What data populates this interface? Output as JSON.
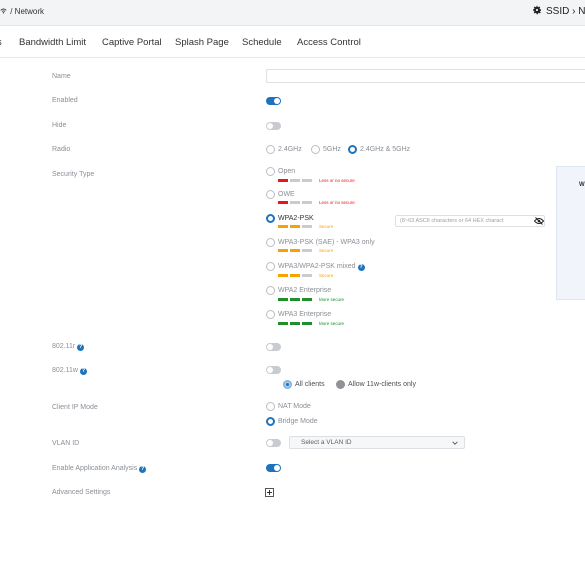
{
  "header": {
    "breadcrumb_text": "/ Network",
    "ssid_text": "SSID › N",
    "icons": {
      "wifi": "wifi-icon",
      "gear": "gear-icon"
    }
  },
  "tabs": [
    {
      "label": "s"
    },
    {
      "label": "Bandwidth Limit"
    },
    {
      "label": "Captive Portal"
    },
    {
      "label": "Splash Page"
    },
    {
      "label": "Schedule"
    },
    {
      "label": "Access Control"
    }
  ],
  "form": {
    "name": {
      "label": "Name",
      "value": ""
    },
    "enabled": {
      "label": "Enabled",
      "on": true
    },
    "hide": {
      "label": "Hide",
      "on": false
    },
    "radio": {
      "label": "Radio",
      "options": [
        "2.4GHz",
        "5GHz",
        "2.4GHz & 5GHz"
      ],
      "selected": "2.4GHz & 5GHz"
    },
    "security_type": {
      "label": "Security Type",
      "selected": "WPA2-PSK",
      "options": [
        {
          "label": "Open",
          "strength": "Less or no secure",
          "level": 1
        },
        {
          "label": "OWE",
          "strength": "Less or no secure",
          "level": 1
        },
        {
          "label": "WPA2-PSK",
          "strength": "Secure",
          "level": 2
        },
        {
          "label": "WPA3-PSK (SAE) - WPA3 only",
          "strength": "Secure",
          "level": 2
        },
        {
          "label": "WPA3/WPA2-PSK mixed",
          "strength": "Secure",
          "level": 2
        },
        {
          "label": "WPA2 Enterprise",
          "strength": "More secure",
          "level": 3
        },
        {
          "label": "WPA3 Enterprise",
          "strength": "More secure",
          "level": 3
        }
      ],
      "key_placeholder": "(8~63 ASCII characters or 64 HEX charact",
      "side_panel_text": "Wi"
    },
    "r80211r": {
      "label": "802.11r",
      "on": false
    },
    "r80211w": {
      "label": "802.11w",
      "on": false,
      "client_options": [
        "All clients",
        "Allow 11w-clients only"
      ],
      "selected": "All clients"
    },
    "client_ip_mode": {
      "label": "Client IP Mode",
      "options": [
        "NAT Mode",
        "Bridge Mode"
      ],
      "selected": "Bridge Mode"
    },
    "vlan_id": {
      "label": "VLAN ID",
      "on": false,
      "placeholder": "Select a VLAN ID"
    },
    "app_analysis": {
      "label": "Enable Application Analysis",
      "on": true
    },
    "advanced": {
      "label": "Advanced Settings"
    }
  },
  "colors": {
    "accent": "#1e73be",
    "weak": "#e8161b",
    "medium": "#f6a300",
    "strong": "#1f8f2d",
    "bar_empty": "#c8ccd1"
  }
}
